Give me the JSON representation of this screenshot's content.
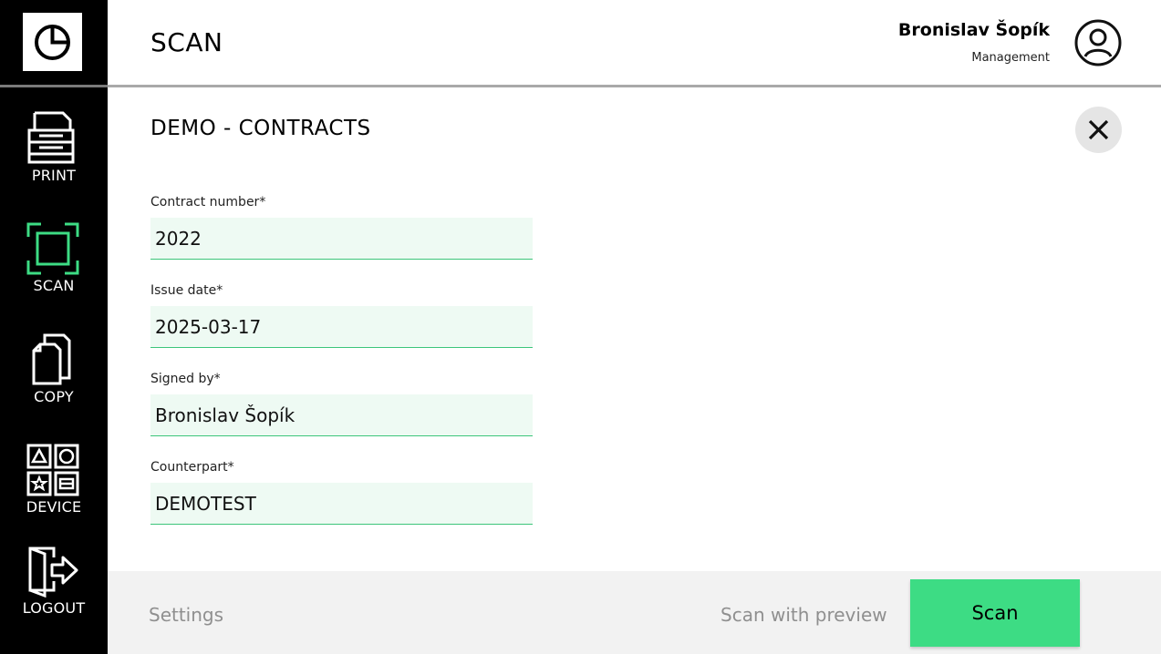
{
  "sidebar": {
    "items": [
      {
        "label": "PRINT",
        "icon": "printer-icon"
      },
      {
        "label": "SCAN",
        "icon": "scan-frame-icon"
      },
      {
        "label": "COPY",
        "icon": "copy-icon"
      },
      {
        "label": "DEVICE",
        "icon": "device-shapes-icon"
      },
      {
        "label": "LOGOUT",
        "icon": "logout-icon"
      }
    ],
    "active_color": "#3ddc84"
  },
  "header": {
    "title": "SCAN",
    "user_name": "Bronislav Šopík",
    "user_role": "Management"
  },
  "form": {
    "title": "DEMO - CONTRACTS",
    "fields": [
      {
        "label": "Contract number*",
        "value": "2022"
      },
      {
        "label": "Issue date*",
        "value": "2025-03-17"
      },
      {
        "label": "Signed by*",
        "value": "Bronislav Šopík"
      },
      {
        "label": "Counterpart*",
        "value": "DEMOTEST"
      }
    ]
  },
  "footer": {
    "settings_label": "Settings",
    "preview_label": "Scan with preview",
    "scan_label": "Scan"
  },
  "colors": {
    "accent": "#3ddc84",
    "input_bg": "#eefaf3",
    "input_border": "#3cc57a",
    "sidebar_bg": "#000000"
  }
}
